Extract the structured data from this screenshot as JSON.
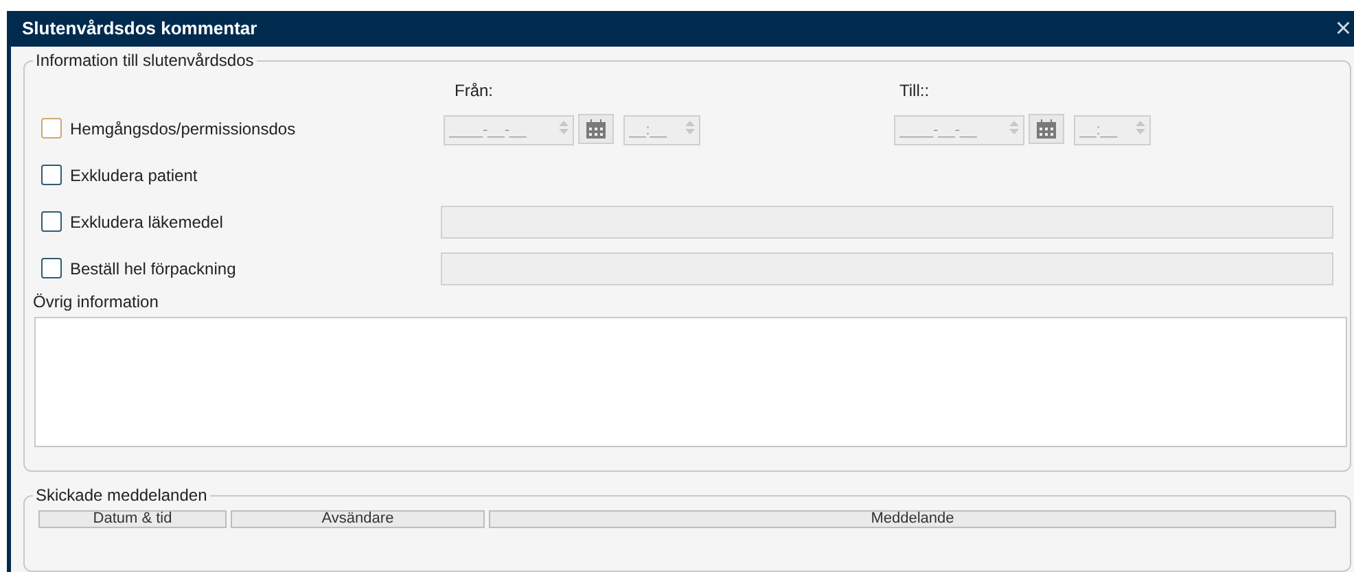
{
  "window": {
    "title": "Slutenvårdsdos kommentar",
    "close": "×"
  },
  "info": {
    "legend": "Information till slutenvårdsdos",
    "from_label": "Från:",
    "to_label": "Till::",
    "from": {
      "date_placeholder": "____-__-__",
      "time_placeholder": "__:__"
    },
    "to": {
      "date_placeholder": "____-__-__",
      "time_placeholder": "__:__"
    },
    "options": [
      {
        "kind": "dates",
        "label": "Hemgångsdos/permissionsdos",
        "checked": false,
        "focused": true
      },
      {
        "kind": "plain",
        "label": "Exkludera patient",
        "checked": false,
        "focused": false
      },
      {
        "kind": "field",
        "label": "Exkludera läkemedel",
        "checked": false,
        "focused": false
      },
      {
        "kind": "field",
        "label": "Beställ hel förpackning",
        "checked": false,
        "focused": false
      }
    ],
    "other_label": "Övrig information"
  },
  "messages": {
    "legend": "Skickade meddelanden",
    "columns": [
      "Datum & tid",
      "Avsändare",
      "Meddelande"
    ]
  }
}
